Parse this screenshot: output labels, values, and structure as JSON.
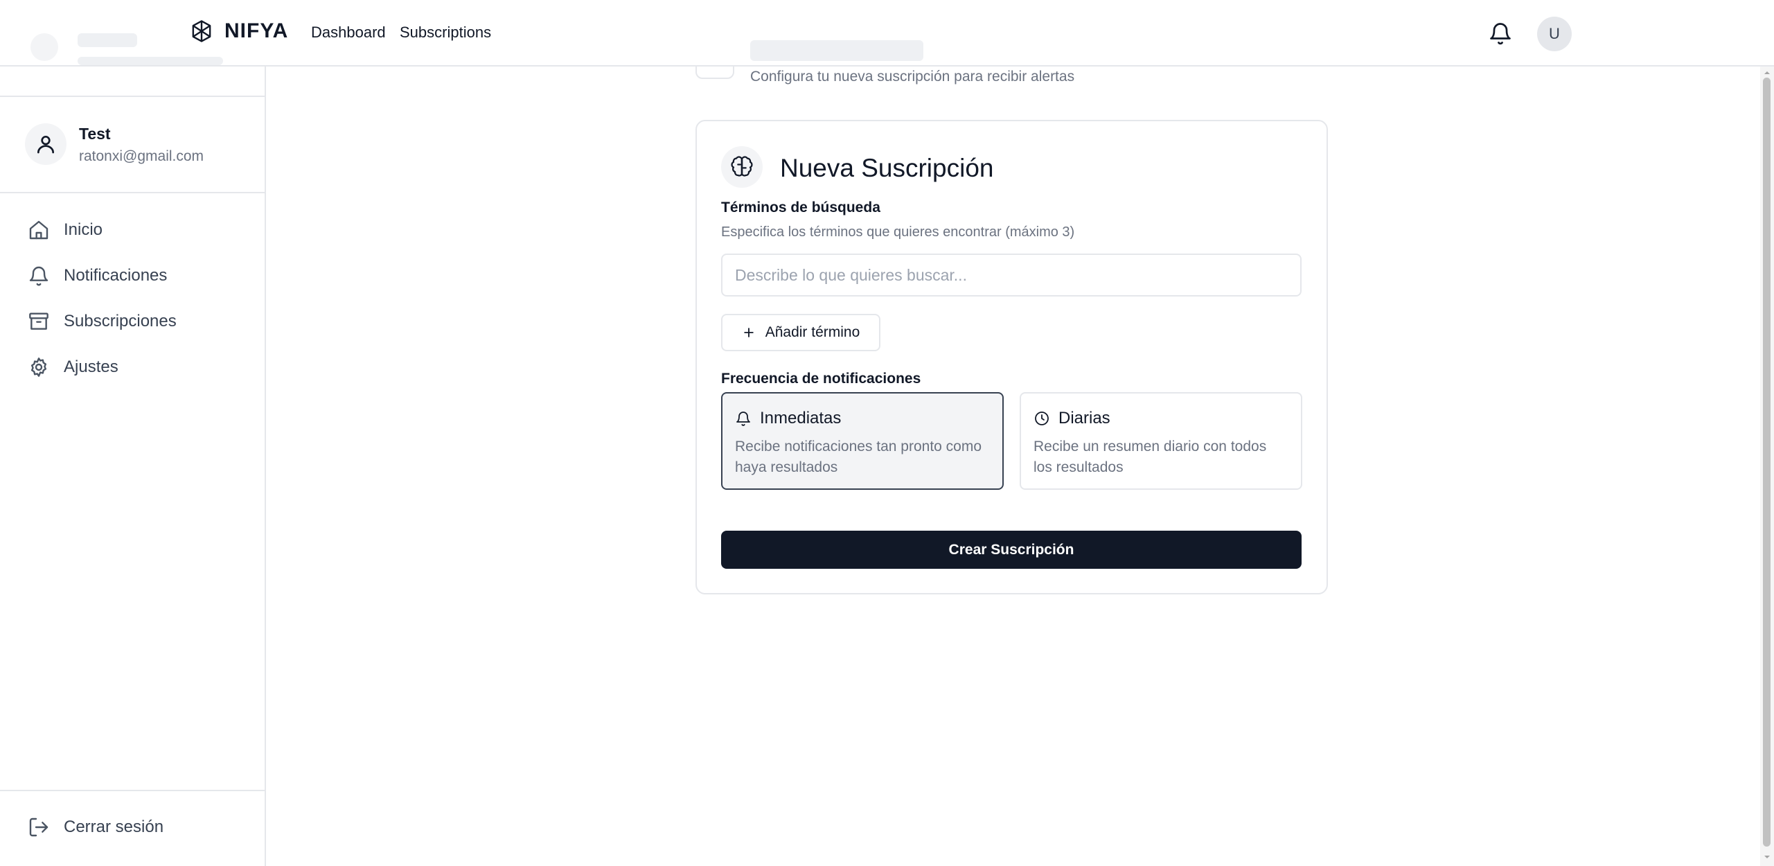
{
  "topbar": {
    "brand": "NIFYA",
    "nav": [
      "Dashboard",
      "Subscriptions"
    ],
    "avatar_initial": "U"
  },
  "sidebar": {
    "profile": {
      "name": "Test",
      "email": "ratonxi@gmail.com"
    },
    "items": [
      {
        "label": "Inicio",
        "icon": "home-icon"
      },
      {
        "label": "Notificaciones",
        "icon": "bell-icon"
      },
      {
        "label": "Subscripciones",
        "icon": "archive-icon"
      },
      {
        "label": "Ajustes",
        "icon": "gear-icon"
      }
    ],
    "logout": {
      "label": "Cerrar sesión",
      "icon": "logout-icon"
    }
  },
  "page": {
    "subtitle": "Configura tu nueva suscripción para recibir alertas"
  },
  "form": {
    "title": "Nueva Suscripción",
    "terms_label": "Términos de búsqueda",
    "terms_help": "Especifica los términos que quieres encontrar (máximo 3)",
    "search_placeholder": "Describe lo que quieres buscar...",
    "add_term_label": "Añadir término",
    "frequency_label": "Frecuencia de notificaciones",
    "frequency_options": [
      {
        "title": "Inmediatas",
        "description": "Recibe notificaciones tan pronto como haya resultados",
        "icon": "bell-icon",
        "selected": true
      },
      {
        "title": "Diarias",
        "description": "Recibe un resumen diario con todos los resultados",
        "icon": "clock-icon",
        "selected": false
      }
    ],
    "submit_label": "Crear Suscripción"
  },
  "colors": {
    "primary_button": "#111827",
    "border": "#e5e7eb",
    "muted_text": "#6b7280",
    "selected_bg": "#f3f4f6"
  }
}
